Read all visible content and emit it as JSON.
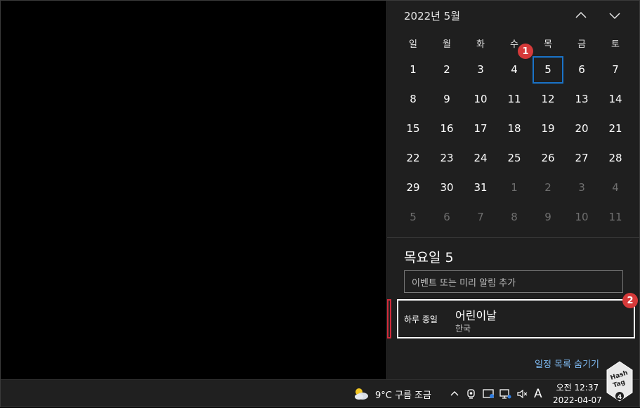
{
  "calendar": {
    "month_label": "2022년 5월",
    "weekdays": [
      "일",
      "월",
      "화",
      "수",
      "목",
      "금",
      "토"
    ],
    "weeks": [
      [
        "1",
        "2",
        "3",
        "4",
        "5",
        "6",
        "7"
      ],
      [
        "8",
        "9",
        "10",
        "11",
        "12",
        "13",
        "14"
      ],
      [
        "15",
        "16",
        "17",
        "18",
        "19",
        "20",
        "21"
      ],
      [
        "22",
        "23",
        "24",
        "25",
        "26",
        "27",
        "28"
      ],
      [
        "29",
        "30",
        "31",
        "1",
        "2",
        "3",
        "4"
      ],
      [
        "5",
        "6",
        "7",
        "8",
        "9",
        "10",
        "11"
      ]
    ],
    "selected": "5"
  },
  "agenda": {
    "day_title": "목요일 5",
    "add_event_placeholder": "이벤트 또는 미리 알림 추가",
    "event": {
      "time": "하루 종일",
      "name": "어린이날",
      "location": "한국"
    },
    "hide_label": "일정 목록 숨기기"
  },
  "badges": {
    "one": "1",
    "two": "2"
  },
  "taskbar": {
    "weather": "9°C  구름 조금",
    "input_indicator": "A",
    "time": "오전 12:37",
    "date": "2022-04-07"
  },
  "logo": {
    "text_line1": "Hash",
    "text_line2": "Tag",
    "number": "4"
  },
  "colors": {
    "selection": "#1a73c8",
    "badge": "#d63a3a",
    "link": "#7db8ef",
    "panel": "#1f1f1f"
  }
}
